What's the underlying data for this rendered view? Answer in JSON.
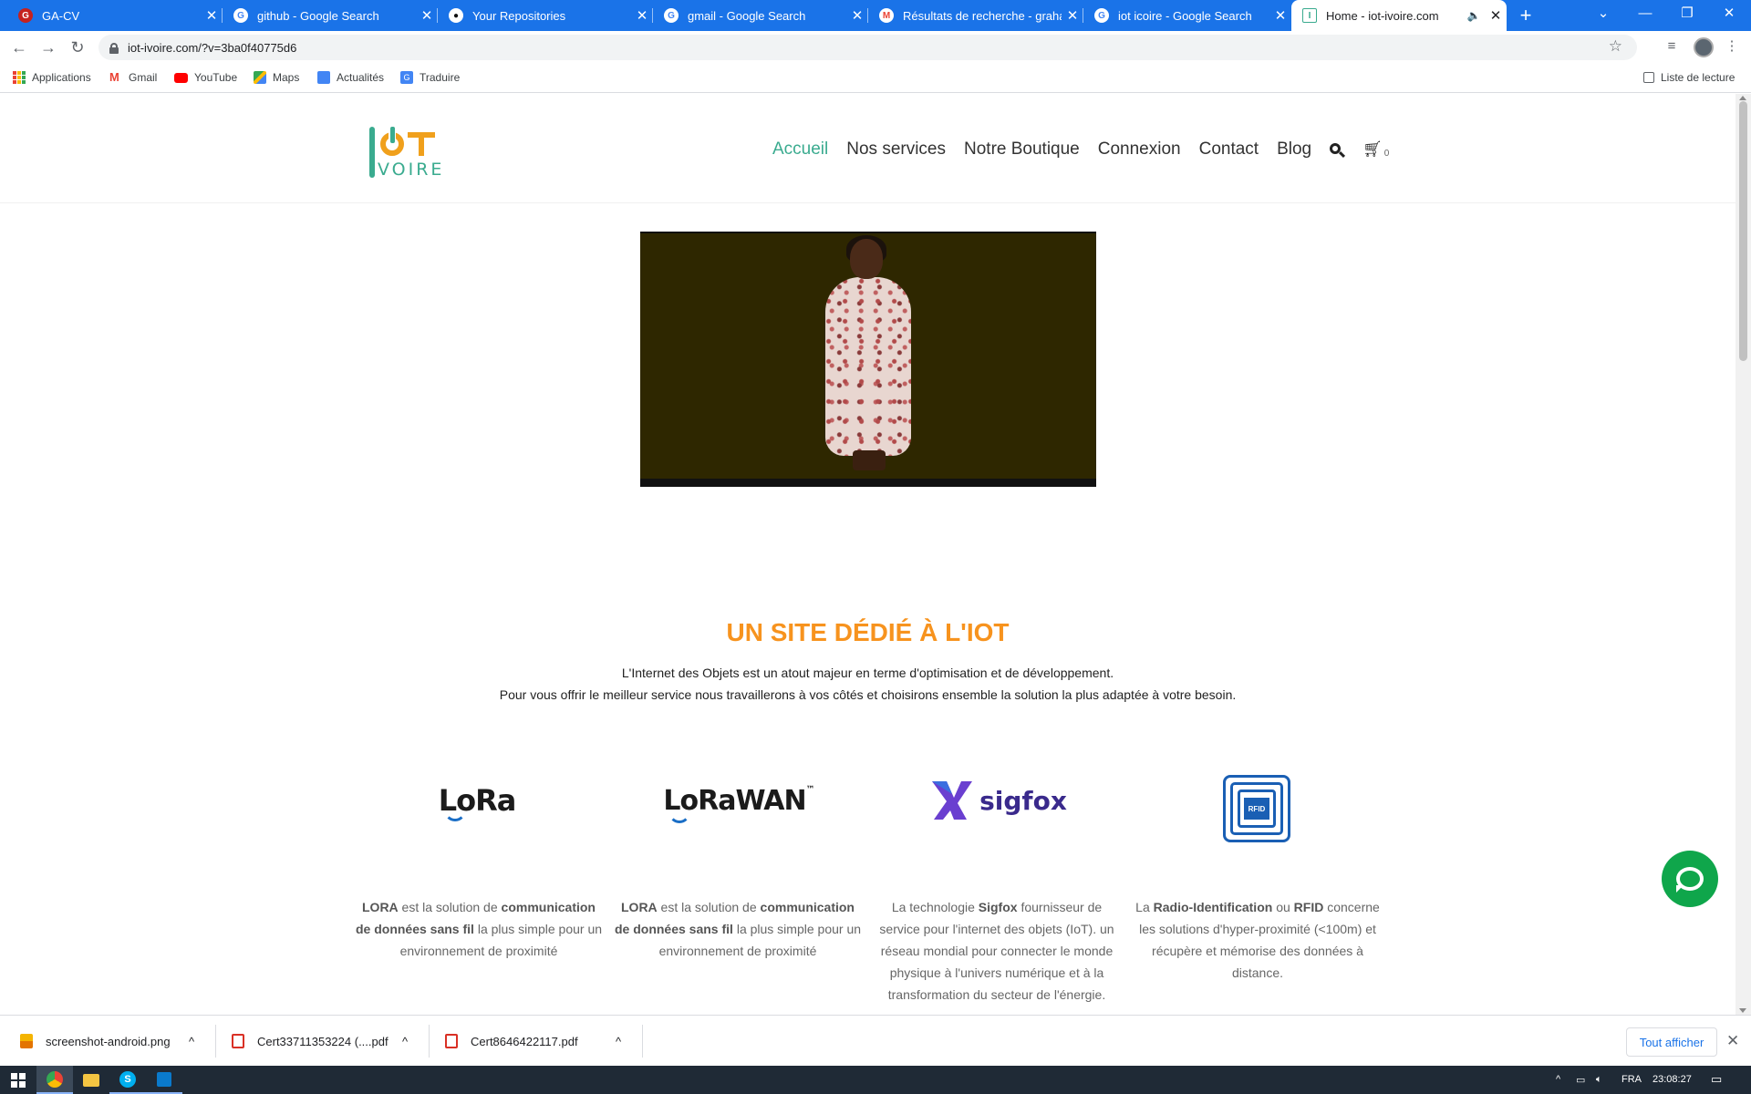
{
  "browser": {
    "tabs": [
      {
        "title": "GA-CV",
        "icon": "ga-icon",
        "left": 0
      },
      {
        "title": "github - Google Search",
        "icon": "google-icon"
      },
      {
        "title": "Your Repositories",
        "icon": "github-icon"
      },
      {
        "title": "gmail - Google Search",
        "icon": "google-icon"
      },
      {
        "title": "Résultats de recherche - grahau",
        "icon": "gmail-icon"
      },
      {
        "title": "iot icoire - Google Search",
        "icon": "google-icon"
      },
      {
        "title": "Home - iot-ivoire.com",
        "icon": "site-icon",
        "active": true
      }
    ],
    "url": "iot-ivoire.com/?v=3ba0f40775d6",
    "bookmarks": [
      "Applications",
      "Gmail",
      "YouTube",
      "Maps",
      "Actualités",
      "Traduire"
    ],
    "reading_list": "Liste de lecture"
  },
  "site": {
    "logo_text": "VOIRE",
    "nav": [
      "Accueil",
      "Nos services",
      "Notre Boutique",
      "Connexion",
      "Contact",
      "Blog"
    ],
    "cart_count": "0",
    "headline": "UN SITE DÉDIÉ À L'IOT",
    "intro_line1": "L'Internet des Objets est un atout majeur en terme d'optimisation et de développement.",
    "intro_line2": "Pour vous offrir le meilleur service nous travaillerons à vos côtés et choisirons ensemble la solution la plus adaptée à votre besoin.",
    "tech": [
      {
        "name": "LoRa",
        "logo": "lora-logo"
      },
      {
        "name": "LoRaWAN",
        "logo": "lorawan-logo"
      },
      {
        "name": "sigfox",
        "logo": "sigfox-logo"
      },
      {
        "name": "RFID",
        "logo": "rfid-logo"
      }
    ],
    "tech_text": {
      "lora": {
        "b1": "LORA",
        "t1": " est la solution de ",
        "b2": "communication de données sans fil",
        "t2": " la plus simple pour un environnement de proximité"
      },
      "lorawan": {
        "b1": "LORA",
        "t1": " est la solution de ",
        "b2": "communication de données sans fil",
        "t2": " la plus simple pour un environnement de proximité"
      },
      "sigfox": {
        "t0": "La technologie ",
        "b1": "Sigfox",
        "t1": "  fournisseur de service pour l'internet des objets (IoT). un réseau mondial pour connecter le monde physique à l'univers numérique  et à la transformation  du secteur de l'énergie."
      },
      "rfid": {
        "t0": "La ",
        "b1": "Radio-Identification",
        "t1": " ou ",
        "b2": "RFID",
        "t2": " concerne les solutions d'hyper-proximité (<100m) et récupère et mémorise des données à distance."
      }
    }
  },
  "downloads": {
    "items": [
      "screenshot-android.png",
      "Cert33711353224 (....pdf",
      "Cert8646422117.pdf"
    ],
    "show_all": "Tout afficher"
  },
  "taskbar": {
    "language": "FRA",
    "time": "23:08:27"
  },
  "colors": {
    "accent": "#3aab8f",
    "headline": "#f7931e",
    "chrome_blue": "#1a73e8"
  }
}
